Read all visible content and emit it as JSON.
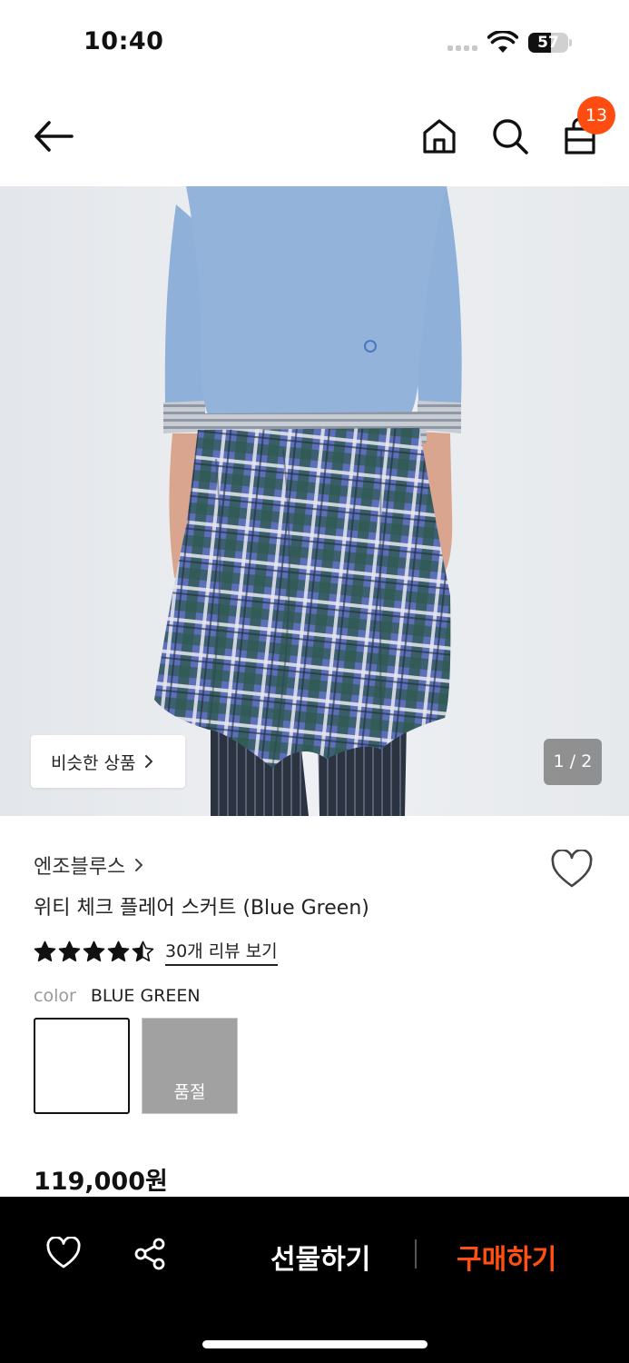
{
  "status_bar": {
    "time": "10:40",
    "battery_level": "57",
    "battery_fraction": 0.57
  },
  "header": {
    "icons": [
      "back-arrow-icon",
      "home-icon",
      "search-icon",
      "shopping-bag-icon"
    ],
    "cart_badge": "13"
  },
  "gallery": {
    "similar_label": "비슷한 상품",
    "counter": "1 / 2"
  },
  "product": {
    "brand": "엔조블루스",
    "title": "위티 체크 플레어 스커트 (Blue Green)",
    "rating": 4.5,
    "review_link": "30개 리뷰 보기",
    "color_label": "color",
    "color_value": "BLUE GREEN",
    "swatches": [
      {
        "label": "",
        "selected": true
      },
      {
        "label": "품절",
        "sold_out": true
      }
    ],
    "price": "119,000원"
  },
  "bottom_bar": {
    "gift_label": "선물하기",
    "buy_label": "구매하기",
    "icons": [
      "heart-icon",
      "share-icon"
    ]
  },
  "colors": {
    "accent": "#ff4d11",
    "bottom_bar": "#000000"
  }
}
